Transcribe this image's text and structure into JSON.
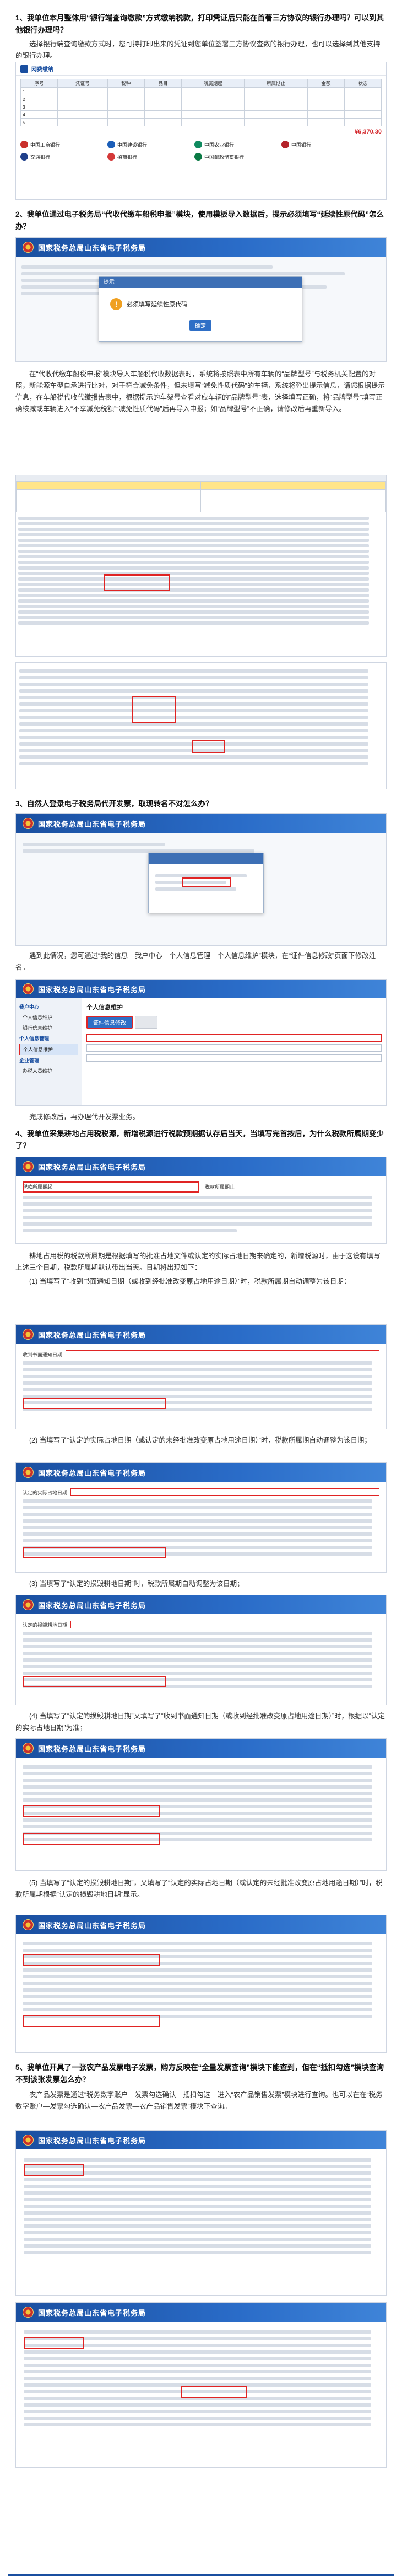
{
  "q1": {
    "title": "1、我单位本月整体用“银行端查询缴款”方式缴纳税款，打印凭证后只能在首著三方协议的银行办理吗？可以到其他银行办理吗？",
    "answer": "选择银行端查询缴款方式时，您可持打印出来的凭证到您单位签署三方协议查数的银行办理，也可以选择到其他支持的银行办理。",
    "shot_brand": "网费缴纳",
    "amount": "¥6,370.30",
    "banks": [
      "中国工商银行",
      "中国建设银行",
      "中国农业银行",
      "中国银行",
      "交通银行",
      "招商银行",
      "中国邮政储蓄银行"
    ]
  },
  "q2": {
    "title": "2、我单位通过电子税务局“代收代缴车船税申报”模块，使用模板导入数据后，提示必须填写“延续性原代码”怎么办？",
    "dialog_title": "提示",
    "dialog_text": "必须填写延续性原代码",
    "dialog_ok": "确定",
    "answer": "在“代收代缴车船税申报”模块导入车船税代收数据表时，系统将按照表中所有车辆的“品牌型号”与税务机关配置的对照，新能源车型自承进行比对，对于符合减免条件，但未填写“减免性质代码”的车辆，系统将弹出提示信息，请您根据提示信息，在车船税代收代缴报告表中，根据提示的车架号查看对应车辆的“品牌型号”表，选择填写正确，将“品牌型号”填写正确核减或车辆进入“不享减免税额”“减免性质代码”后再导入申报；如“品牌型号”不正确，请修改后再重新导入。",
    "banner": "国家税务总局山东省电子税务局"
  },
  "q3": {
    "title": "3、自然人登录电子税务局代开发票，取现转名不对怎么办？",
    "banner": "国家税务总局山东省电子税务局",
    "answer": "遇到此情况，您可通过“我的信息—我户中心—个人信息管理—个人信息维护”模块，在“证件信息修改”页面下修改姓名。",
    "shot2_title": "个人信息维护",
    "tab_label": "证件信息修改",
    "menu": [
      "我户中心",
      "个人信息维护",
      "银行信息维护",
      "个人信息管理",
      "个人信息维护",
      "企业管理",
      "办税人员维护"
    ],
    "after": "完成修改后，再办理代开发票业务。"
  },
  "q4": {
    "title": "4、我单位采集耕地占用税税源，新增税源进行税款预期据认存后当天，当填写完首按后，为什么税款所属期变少了？",
    "banner": "国家税务总局山东省电子税务局",
    "answer": "耕地占用税的税款所属期是根据填写的批准占地文件或认定的实际占地日期来确定的，新增税源时，由于这设有填写上述三个日期，税款所属期默认带出当天。日期将出现如下：",
    "case1": "(1) 当填写了“收到书面通知日期（或收到经批准改变原占地用途日期）”时，税款所属期自动调整为该日期：",
    "case2": "(2) 当填写了“认定的实际占地日期（或认定的未经批准改变原占地用途日期）”时，税款所属期自动调整为该日期；",
    "case3": "(3) 当填写了“认定的损毁耕地日期”时，税款所属期自动调整为该日期；",
    "case4": "(4) 当填写了“认定的损毁耕地日期”又填写了“收到书面通知日期（或收到经批准改变原占地用途日期）”时，根据以“认定的实际占地日期”为准；",
    "case5": "(5) 当填写了“认定的损毁耕地日期”，又填写了“认定的实际占地日期（或认定的未经批准改变原占地用途日期）”时，税款所属期根据“认定的损毁耕地日期”显示。",
    "labels": [
      "收到书面通知日期",
      "认定的实际占地日期",
      "认定的损毁耕地日期",
      "税款所属期起",
      "税款所属期止"
    ]
  },
  "q5": {
    "title": "5、我单位开具了一张农产品发票电子发票，购方反映在“全量发票查询”模块下能查到，但在“抵扣勾选”模块查询不到该张发票怎么办？",
    "answer": "农产品发票是通过“税务数字账户—发票勾选确认—抵扣勾选—进入“农产品销售发票”模块进行查询。也可以在在“税务数字账户—发票勾选确认—农产品发票—农产品销售发票”模块下查询。",
    "banner": "国家税务总局山东省电子税务局"
  }
}
